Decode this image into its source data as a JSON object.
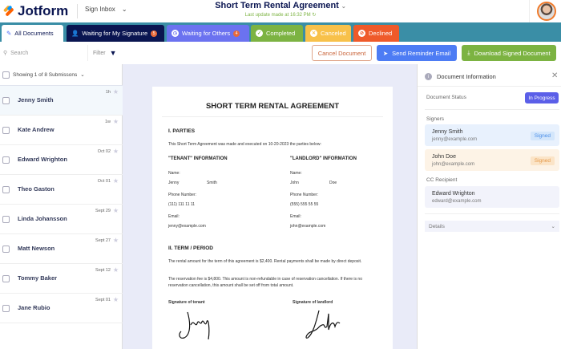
{
  "header": {
    "logo": "Jotform",
    "inbox": "Sign Inbox",
    "title": "Short Term Rental Agreement",
    "subtitle": "Last update made at 16:32 PM"
  },
  "tabs": [
    {
      "label": "All Documents",
      "color": "#ffffff"
    },
    {
      "label": "Waiting for My Signature",
      "badge": "5",
      "color": "#0a1551"
    },
    {
      "label": "Waiting for Others",
      "badge": "4",
      "color": "#6b72f0"
    },
    {
      "label": "Completed",
      "color": "#7cb342"
    },
    {
      "label": "Canceled",
      "color": "#f8c14a"
    },
    {
      "label": "Declined",
      "color": "#ef5a2a"
    }
  ],
  "toolbar": {
    "search_placeholder": "Search",
    "filter": "Filter",
    "cancel": "Cancel Document",
    "remind": "Send Reminder Email",
    "download": "Download Signed Document"
  },
  "list": {
    "showing": "Showing 1 of 8 Submissons",
    "items": [
      {
        "name": "Jenny Smith",
        "date": "1h"
      },
      {
        "name": "Kate Andrew",
        "date": "1w"
      },
      {
        "name": "Edward Wrighton",
        "date": "Oct 02"
      },
      {
        "name": "Theo Gaston",
        "date": "Oct 01"
      },
      {
        "name": "Linda Johansson",
        "date": "Sept 29"
      },
      {
        "name": "Matt Newson",
        "date": "Sept 27"
      },
      {
        "name": "Tommy Baker",
        "date": "Sept 12"
      },
      {
        "name": "Jane Rubio",
        "date": "Sept 01"
      }
    ]
  },
  "doc": {
    "title": "SHORT TERM RENTAL AGREEMENT",
    "s1": "I. PARTIES",
    "intro": "This Short Term Agreement was made and executed on 10-20-2023 the parties below:",
    "tenant": {
      "h": "\"TENANT\" INFORMATION",
      "name_l": "Name:",
      "first": "Jenny",
      "last": "Smith",
      "phone_l": "Phone Number:",
      "phone": "(111) 111 11 11",
      "email_l": "Email:",
      "email": "jenny@example.com"
    },
    "landlord": {
      "h": "\"LANDLORD\" INFORMATION",
      "name_l": "Name:",
      "first": "John",
      "last": "Doe",
      "phone_l": "Phone Number:",
      "phone": "(555) 555 55 55",
      "email_l": "Email:",
      "email": "john@example.com"
    },
    "s2": "II. TERM / PERIOD",
    "p1": "The rental amount for the term of this agreement is $2,400. Rental payments shall be made by direct deposit.",
    "p2": "The reservation fee is $4,800. This amount is non-refundable in case of reservation cancellation. If there is no reservation cancellation, this amount shall be set off from total amount.",
    "sig_tenant": "Signature of tenant",
    "sig_landlord": "Signature of landlord"
  },
  "info": {
    "title": "Document Information",
    "status_label": "Document Status",
    "status": "In Progress",
    "signers_label": "Signers",
    "signers": [
      {
        "name": "Jenny Smith",
        "email": "jenny@example.com",
        "status": "Signed"
      },
      {
        "name": "John Doe",
        "email": "john@example.com",
        "status": "Signed"
      }
    ],
    "cc_label": "CC Recipient",
    "cc": {
      "name": "Edward Wrighton",
      "email": "edward@example.com"
    },
    "details": "Details"
  }
}
